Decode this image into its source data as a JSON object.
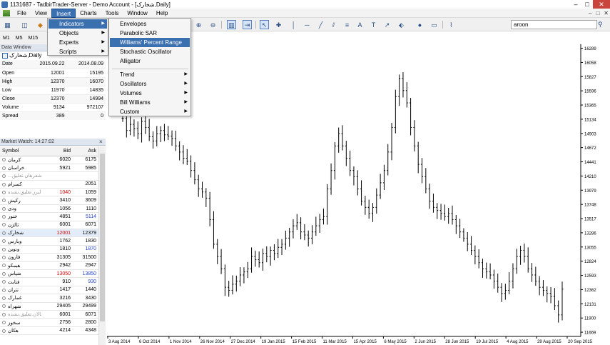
{
  "window": {
    "title": "1131687 - TadbirTrader-Server - Demo Account - [شخارک,Daily]",
    "controls": [
      "–",
      "□",
      "✕"
    ]
  },
  "menubar": {
    "items": [
      "File",
      "View",
      "Insert",
      "Charts",
      "Tools",
      "Window",
      "Help"
    ],
    "active": "Insert",
    "mdi_controls": [
      "–",
      "□",
      "✕"
    ]
  },
  "toolbar": {
    "search_value": "aroon"
  },
  "timeframes": [
    "M1",
    "M5",
    "M15"
  ],
  "insert_menu": {
    "items": [
      {
        "label": "Indicators",
        "submenu": true,
        "selected": true
      },
      {
        "label": "Objects",
        "submenu": true
      },
      {
        "label": "Experts",
        "submenu": true
      },
      {
        "label": "Scripts",
        "submenu": true
      }
    ]
  },
  "indicators_menu": {
    "group1": [
      {
        "label": "Envelopes"
      },
      {
        "label": "Parabolic SAR"
      },
      {
        "label": "Williams' Percent Range",
        "selected": true
      },
      {
        "label": "Stochastic Oscillator"
      },
      {
        "label": "Alligator"
      }
    ],
    "group2": [
      {
        "label": "Trend"
      },
      {
        "label": "Oscillators"
      },
      {
        "label": "Volumes"
      },
      {
        "label": "Bill Williams"
      },
      {
        "label": "Custom"
      }
    ]
  },
  "data_window": {
    "header": "Data Window",
    "symbol": "شخارک,Daily",
    "rows": [
      {
        "label": "Date",
        "v1": "2015.09.22",
        "v2": "2014.08.09"
      },
      {
        "label": "Open",
        "v1": "12001",
        "v2": "15195"
      },
      {
        "label": "High",
        "v1": "12370",
        "v2": "16070"
      },
      {
        "label": "Low",
        "v1": "11970",
        "v2": "14835"
      },
      {
        "label": "Close",
        "v1": "12370",
        "v2": "14994"
      },
      {
        "label": "Volume",
        "v1": "9134",
        "v2": "972107"
      },
      {
        "label": "Spread",
        "v1": "389",
        "v2": "0"
      }
    ]
  },
  "market_watch": {
    "header": "Market Watch: 14:27:02",
    "columns": [
      "Symbol",
      "Bid",
      "Ask"
    ],
    "rows": [
      {
        "symbol": "کرمان",
        "bid": "6020",
        "ask": "6175"
      },
      {
        "symbol": "خراسان",
        "bid": "5921",
        "ask": "5985"
      },
      {
        "symbol": "...شفرهان.تعلیق",
        "bid": "",
        "ask": "",
        "inactive": true
      },
      {
        "symbol": "کسرام",
        "bid": "",
        "ask": "2051"
      },
      {
        "symbol": "البرز.تعلیق.نشده",
        "bid": "1040",
        "ask": "1059",
        "inactive": true,
        "bid_color": "#d00000"
      },
      {
        "symbol": "رکیش",
        "bid": "3410",
        "ask": "3609"
      },
      {
        "symbol": "ودی",
        "bid": "1056",
        "ask": "1110"
      },
      {
        "symbol": "خنور",
        "bid": "4851",
        "ask": "5114",
        "ask_color": "#1f3fd0"
      },
      {
        "symbol": "ثالژن",
        "bid": "6001",
        "ask": "6071"
      },
      {
        "symbol": "شخارک",
        "bid": "12001",
        "ask": "12379",
        "highlight": true,
        "bid_color": "#d00000"
      },
      {
        "symbol": "وبارس",
        "bid": "1762",
        "ask": "1830"
      },
      {
        "symbol": "ونوین",
        "bid": "1810",
        "ask": "1870",
        "ask_color": "#1f3fd0"
      },
      {
        "symbol": "فارون",
        "bid": "31305",
        "ask": "31500"
      },
      {
        "symbol": "هیمکو",
        "bid": "2942",
        "ask": "2947"
      },
      {
        "symbol": "شپاس",
        "bid": "13050",
        "ask": "13850",
        "bid_color": "#d00000",
        "ask_color": "#1f3fd0"
      },
      {
        "symbol": "فتابت",
        "bid": "910",
        "ask": "930",
        "ask_color": "#1f3fd0"
      },
      {
        "symbol": "تتران",
        "bid": "1417",
        "ask": "1440"
      },
      {
        "symbol": "غمارک",
        "bid": "3216",
        "ask": "3430"
      },
      {
        "symbol": "شهراه",
        "bid": "29405",
        "ask": "29499"
      },
      {
        "symbol": "ثالان.تعلیق.نشده",
        "bid": "6001",
        "ask": "6071",
        "inactive": true
      },
      {
        "symbol": "سخوز",
        "bid": "2756",
        "ask": "2800"
      },
      {
        "symbol": "هکان",
        "bid": "4214",
        "ask": "4348"
      }
    ]
  },
  "chart_data": {
    "type": "ohlc",
    "y_ticks": [
      16289,
      16058,
      15827,
      15596,
      15365,
      15134,
      14903,
      14672,
      14441,
      14210,
      13979,
      13748,
      13517,
      13286,
      13055,
      12824,
      12593,
      12362,
      12131,
      11900,
      11669
    ],
    "x_ticks": [
      "3 Aug 2014",
      "6 Oct 2014",
      "1 Nov 2014",
      "26 Nov 2014",
      "27 Dec 2014",
      "19 Jan 2015",
      "15 Feb 2015",
      "11 Mar 2015",
      "15 Apr 2015",
      "6 May 2015",
      "2 Jun 2015",
      "28 Jun 2015",
      "19 Jul 2015",
      "4 Aug 2015",
      "29 Aug 2015",
      "20 Sep 2015"
    ],
    "ylim": [
      11600,
      16330
    ],
    "close_path": [
      15150,
      14950,
      15050,
      14980,
      14900,
      15100,
      15000,
      14850,
      14780,
      14900,
      14950,
      14880,
      14860,
      14820,
      14700,
      14600,
      14500,
      14450,
      14300,
      14150,
      14000,
      13950,
      13850,
      13500,
      13100,
      12900,
      12700,
      12400,
      12350,
      12450,
      12500,
      12600,
      12650,
      12700,
      12900,
      12850,
      12800,
      12950,
      12900,
      13000,
      12950,
      13050,
      13100,
      13200,
      13300,
      13400,
      13450,
      13300,
      13250,
      13200,
      13300,
      13400,
      13500,
      13550,
      14000,
      14300,
      14700,
      14900,
      14700,
      14500,
      14300,
      14200,
      14000,
      13800,
      13700,
      13600,
      13700,
      13900,
      14100,
      14300,
      14600,
      15000,
      15500,
      15800,
      15600,
      15400,
      15000,
      14700,
      14400,
      14200,
      14000,
      13800,
      13700,
      13650,
      13600,
      13550,
      13600,
      13500,
      13400,
      13300,
      13200,
      13100,
      13000,
      12900,
      12800,
      12700,
      12650,
      12600,
      12500,
      12400,
      12300,
      12350,
      12500,
      12700,
      12900,
      13000,
      12900,
      12700,
      12600,
      12500,
      12400,
      12350,
      12300,
      12250,
      12100,
      11950,
      12370
    ]
  }
}
